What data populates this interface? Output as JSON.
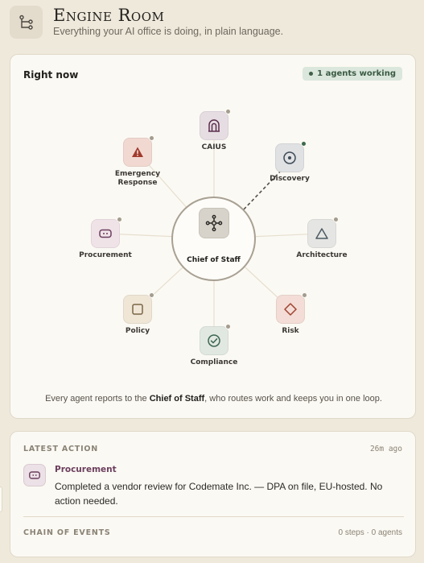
{
  "header": {
    "title": "Engine Room",
    "subtitle": "Everything your AI office is doing, in plain language."
  },
  "status_panel": {
    "heading": "Right now",
    "badge": "1 agents working",
    "center": {
      "label": "Chief of Staff",
      "icon": "hub-icon"
    },
    "agents": [
      {
        "key": "caius",
        "label": "CAIUS",
        "icon": "archway-icon",
        "bg": "#e6dde3",
        "color": "#5b2e4c",
        "active": false
      },
      {
        "key": "discovery",
        "label": "Discovery",
        "icon": "target-icon",
        "bg": "#dfe1e3",
        "color": "#3d4a57",
        "active": true
      },
      {
        "key": "architecture",
        "label": "Architecture",
        "icon": "triangle-icon",
        "bg": "#e5e6e3",
        "color": "#4d5a63",
        "active": false
      },
      {
        "key": "risk",
        "label": "Risk",
        "icon": "diamond-icon",
        "bg": "#f3ddd6",
        "color": "#a04433",
        "active": false
      },
      {
        "key": "compliance",
        "label": "Compliance",
        "icon": "check-circle-icon",
        "bg": "#e1e8e2",
        "color": "#3c6650",
        "active": false
      },
      {
        "key": "policy",
        "label": "Policy",
        "icon": "square-icon",
        "bg": "#efe6d6",
        "color": "#7a6647",
        "active": false
      },
      {
        "key": "procurement",
        "label": "Procurement",
        "icon": "card-icon",
        "bg": "#f0e3e8",
        "color": "#6b3e5d",
        "active": false
      },
      {
        "key": "emergency",
        "label": "Emergency\nResponse",
        "icon": "warning-icon",
        "bg": "#f1d9d2",
        "color": "#a03a2c",
        "active": false
      }
    ],
    "footnote": {
      "before": "Every agent reports to the ",
      "strong": "Chief of Staff",
      "after": ", who routes work and keeps you in one loop."
    }
  },
  "latest_action": {
    "heading": "LATEST ACTION",
    "time": "26m ago",
    "agent": "Procurement",
    "agent_icon": "card-icon",
    "text": "Completed a vendor review for Codemate Inc. — DPA on file, EU-hosted. No action needed."
  },
  "chain": {
    "heading": "CHAIN OF EVENTS",
    "count": "0 steps · 0 agents"
  }
}
